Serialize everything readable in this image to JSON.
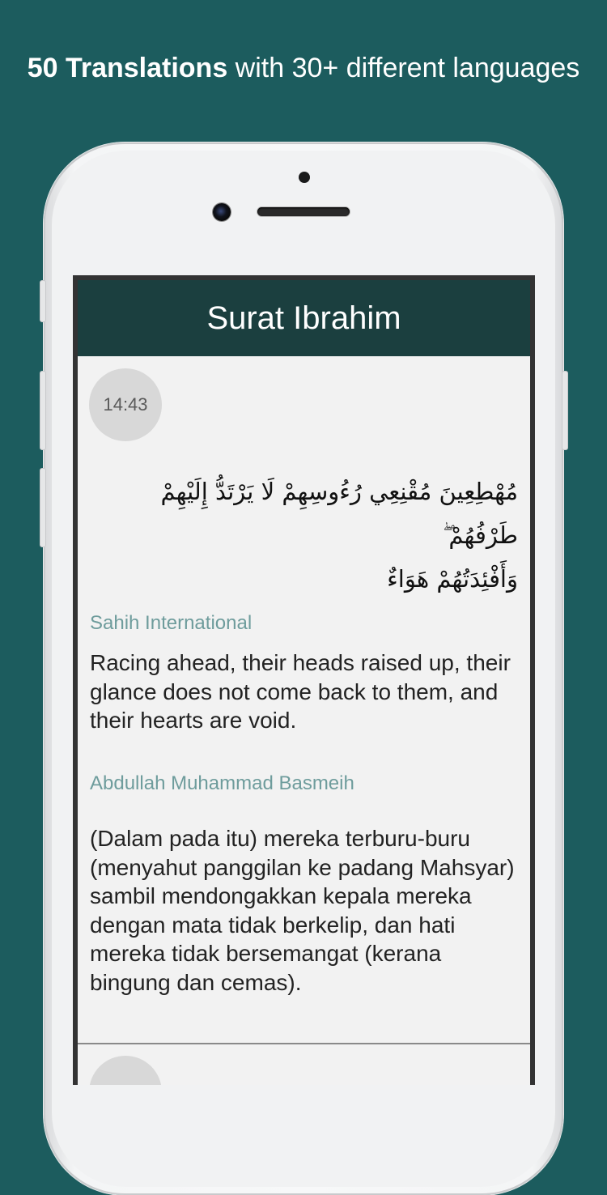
{
  "headline": {
    "bold": "50 Translations",
    "rest": " with 30+ different languages"
  },
  "appbar": {
    "title": "Surat Ibrahim"
  },
  "verse": {
    "time": "14:43",
    "arabic_line1": "مُهْطِعِينَ مُقْنِعِي رُءُوسِهِمْ لَا يَرْتَدُّ إِلَيْهِمْ طَرْفُهُمْ ۖ",
    "arabic_line2": "وَأَفْئِدَتُهُمْ هَوَاءٌ"
  },
  "translations": [
    {
      "name": "Sahih International",
      "text": "Racing ahead, their heads raised up, their glance does not come back to them, and their hearts are void."
    },
    {
      "name": "Abdullah Muhammad Basmeih",
      "text": "(Dalam pada itu) mereka terburu-buru (menyahut panggilan ke padang Mahsyar) sambil mendongakkan kepala mereka dengan mata tidak berkelip, dan hati mereka tidak bersemangat (kerana bingung dan cemas)."
    }
  ],
  "colors": {
    "background": "#1c5c5e",
    "appbar": "#1b3f3f",
    "translator_name": "#6e9c9c"
  }
}
